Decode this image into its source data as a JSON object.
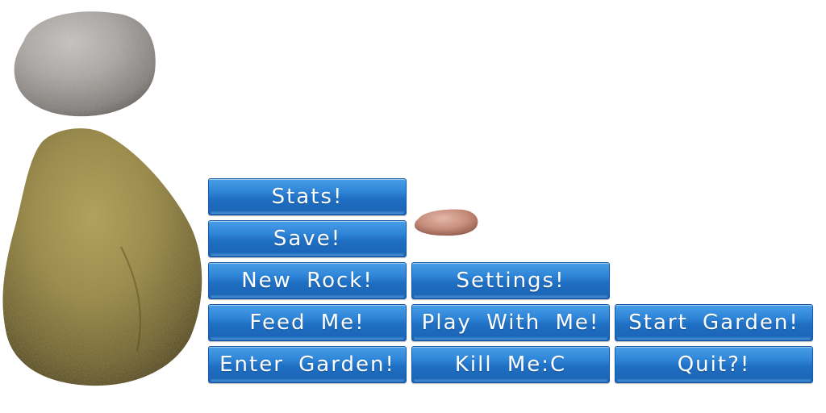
{
  "buttons": {
    "stats": "Stats!",
    "save": "Save!",
    "new_rock": "New Rock!",
    "settings": "Settings!",
    "feed_me": "Feed Me!",
    "play_with_me": "Play With Me!",
    "start_garden": "Start Garden!",
    "enter_garden": "Enter Garden!",
    "kill_me": "Kill Me:C",
    "quit": "Quit?!"
  },
  "colors": {
    "button_blue": "#2f86d8",
    "button_text": "#ffffff",
    "background": "#ffffff"
  }
}
